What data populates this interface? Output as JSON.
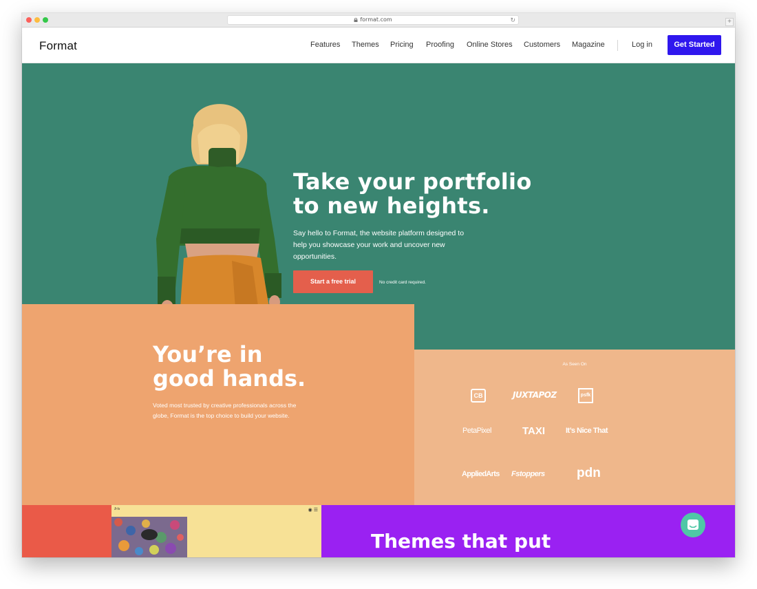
{
  "browser": {
    "url": "format.com",
    "new_tab": "+"
  },
  "header": {
    "logo": "Format",
    "nav": [
      "Features",
      "Themes",
      "Pricing",
      "Proofing",
      "Online Stores",
      "Customers",
      "Magazine"
    ],
    "login": "Log in",
    "cta": "Get Started"
  },
  "hero": {
    "title_line1": "Take your portfolio",
    "title_line2": "to new heights.",
    "subtitle": "Say hello to Format, the website platform designed to help you showcase your work and uncover new opportunities.",
    "trial_button": "Start a free trial",
    "no_card": "No credit card required."
  },
  "hands": {
    "title_line1": "You’re in",
    "title_line2": "good hands.",
    "subtitle": "Voted most trusted by creative professionals across the globe, Format is the top choice to build your website."
  },
  "press": {
    "heading": "As Seen On",
    "logos": [
      "CB",
      "JUXTAPOZ",
      "psfk",
      "PetaPixel",
      "TAXI",
      "It’s Nice That",
      "AppliedArts",
      "Fstoppers",
      "pdn"
    ]
  },
  "theme_preview": {
    "name": "Iris",
    "icons": "◉ ☰"
  },
  "themes": {
    "title": "Themes that put"
  },
  "colors": {
    "hero_bg": "#3a8571",
    "cta_bg": "#2f17ee",
    "trial_bg": "#e45f4c",
    "hands_bg": "#eea46f",
    "press_bg": "#efb78b",
    "themes_bg": "#9a21f2",
    "chat_bg": "#4fc7a6"
  }
}
